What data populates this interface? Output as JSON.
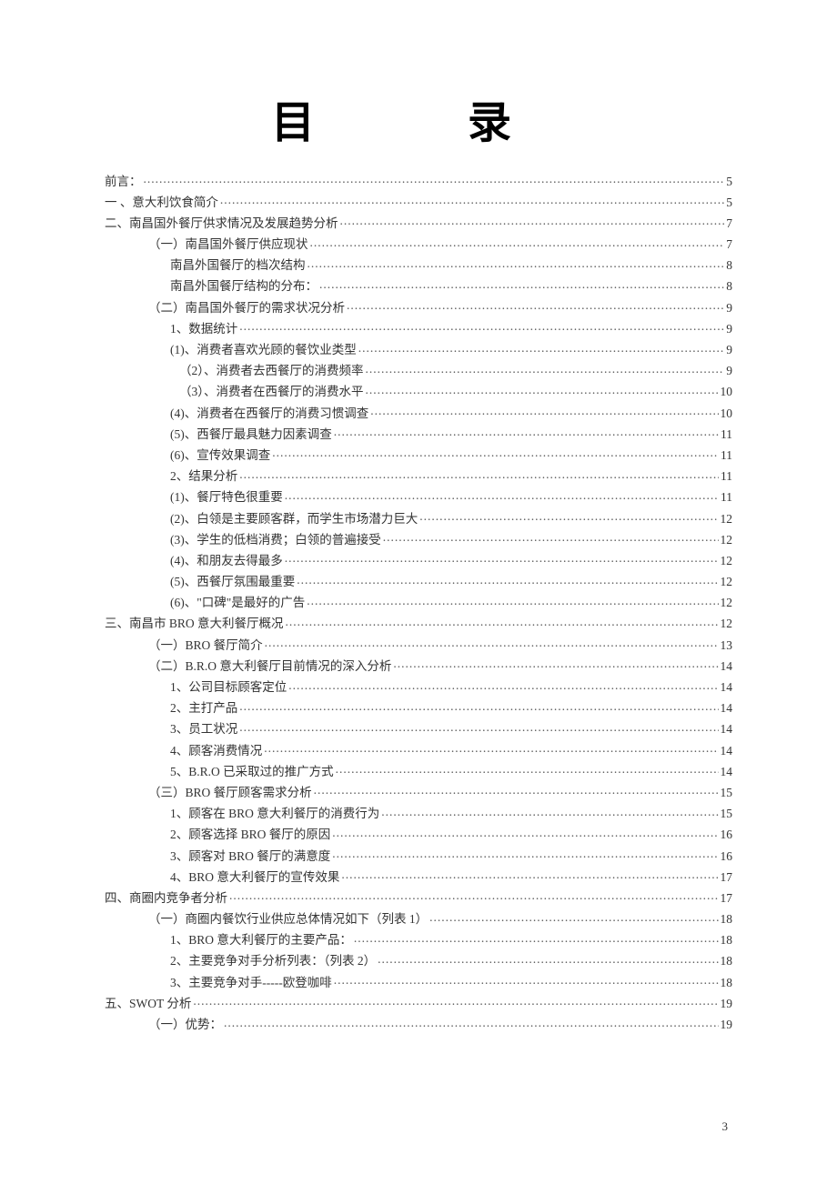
{
  "title": "目　录",
  "page_number": "3",
  "toc": [
    {
      "indent": 0,
      "text": "前言：",
      "page": "5"
    },
    {
      "indent": 0,
      "text": "一 、意大利饮食简介",
      "page": "5"
    },
    {
      "indent": 0,
      "text": "二、南昌国外餐厅供求情况及发展趋势分析",
      "page": "7"
    },
    {
      "indent": 1,
      "text": "（一）南昌国外餐厅供应现状",
      "page": "7"
    },
    {
      "indent": 2,
      "text": "南昌外国餐厅的档次结构",
      "page": "8"
    },
    {
      "indent": 2,
      "text": "南昌外国餐厅结构的分布：",
      "page": "8"
    },
    {
      "indent": 1,
      "text": "（二）南昌国外餐厅的需求状况分析",
      "page": "9"
    },
    {
      "indent": 2,
      "text": "1、数据统计",
      "page": "9"
    },
    {
      "indent": 2,
      "text": "(1)、消费者喜欢光顾的餐饮业类型",
      "page": "9"
    },
    {
      "indent": 3,
      "text": "（2）、消费者去西餐厅的消费频率",
      "page": "9"
    },
    {
      "indent": 3,
      "text": "（3）、消费者在西餐厅的消费水平",
      "page": "10"
    },
    {
      "indent": 2,
      "text": "(4)、消费者在西餐厅的消费习惯调查",
      "page": "10"
    },
    {
      "indent": 2,
      "text": "(5)、西餐厅最具魅力因素调查",
      "page": "11"
    },
    {
      "indent": 2,
      "text": "(6)、宣传效果调查",
      "page": "11"
    },
    {
      "indent": 2,
      "text": "2、结果分析",
      "page": "11"
    },
    {
      "indent": 2,
      "text": "(1)、餐厅特色很重要",
      "page": "11"
    },
    {
      "indent": 2,
      "text": "(2)、白领是主要顾客群，而学生市场潜力巨大",
      "page": "12"
    },
    {
      "indent": 2,
      "text": "(3)、学生的低档消费；白领的普遍接受",
      "page": "12"
    },
    {
      "indent": 2,
      "text": "(4)、和朋友去得最多",
      "page": "12"
    },
    {
      "indent": 2,
      "text": "(5)、西餐厅氛围最重要",
      "page": "12"
    },
    {
      "indent": 2,
      "text": "(6)、\"口碑\"是最好的广告",
      "page": "12"
    },
    {
      "indent": 0,
      "text": "三、南昌市 BRO 意大利餐厅概况",
      "page": "12"
    },
    {
      "indent": 1,
      "text": "（一）BRO 餐厅简介",
      "page": "13"
    },
    {
      "indent": 1,
      "text": "（二）B.R.O 意大利餐厅目前情况的深入分析",
      "page": "14"
    },
    {
      "indent": 2,
      "text": "1、公司目标顾客定位",
      "page": "14"
    },
    {
      "indent": 2,
      "text": "2、主打产品",
      "page": "14"
    },
    {
      "indent": 2,
      "text": "3、员工状况",
      "page": "14"
    },
    {
      "indent": 2,
      "text": "4、顾客消费情况",
      "page": "14"
    },
    {
      "indent": 2,
      "text": "5、B.R.O 已采取过的推广方式",
      "page": "14"
    },
    {
      "indent": 1,
      "text": "（三）BRO 餐厅顾客需求分析",
      "page": "15"
    },
    {
      "indent": 2,
      "text": "1、顾客在 BRO 意大利餐厅的消费行为",
      "page": "15"
    },
    {
      "indent": 2,
      "text": "2、顾客选择 BRO 餐厅的原因",
      "page": "16"
    },
    {
      "indent": 2,
      "text": "3、顾客对 BRO 餐厅的满意度",
      "page": "16"
    },
    {
      "indent": 2,
      "text": "4、BRO 意大利餐厅的宣传效果",
      "page": "17"
    },
    {
      "indent": 0,
      "text": "四、商圈内竞争者分析",
      "page": "17"
    },
    {
      "indent": 1,
      "text": "（一）商圈内餐饮行业供应总体情况如下（列表 1）",
      "page": "18"
    },
    {
      "indent": 2,
      "text": "1、BRO 意大利餐厅的主要产品：",
      "page": "18"
    },
    {
      "indent": 2,
      "text": "2、主要竞争对手分析列表：（列表 2）",
      "page": "18"
    },
    {
      "indent": 2,
      "text": "3、主要竞争对手-----欧登咖啡",
      "page": "18"
    },
    {
      "indent": 0,
      "text": "五、SWOT 分析",
      "page": "19"
    },
    {
      "indent": 1,
      "text": "（一）优势：",
      "page": "19"
    }
  ]
}
